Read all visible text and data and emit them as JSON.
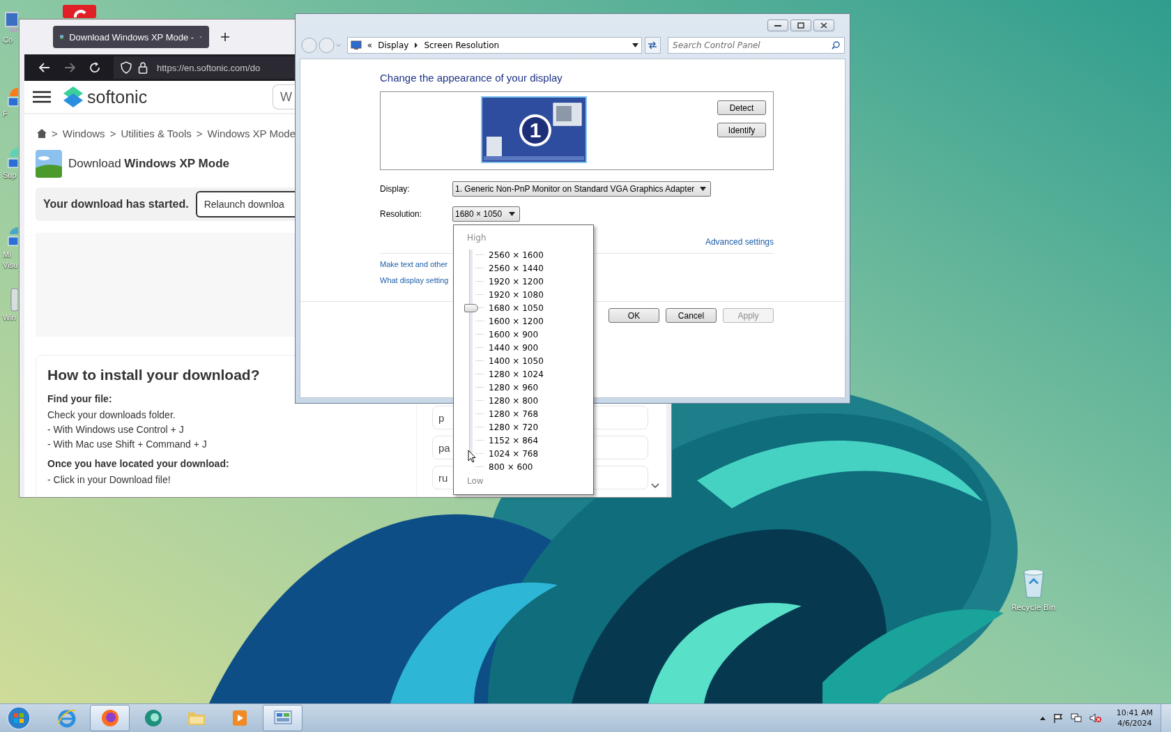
{
  "desktop": {
    "icons": [
      {
        "kind": "computer",
        "label": "Co"
      },
      {
        "kind": "firefox",
        "label": "F"
      },
      {
        "kind": "support",
        "label": "Sup"
      },
      {
        "kind": "studio",
        "label": "Mi Visu"
      },
      {
        "kind": "drive",
        "label": "Win"
      }
    ],
    "recycle_bin": {
      "label": "Recycle Bin"
    }
  },
  "browser": {
    "tab_title": "Download Windows XP Mode -",
    "url": "https://en.softonic.com/do",
    "logo": "softonic",
    "search": "W",
    "breadcrumb": [
      "Windows",
      "Utilities & Tools",
      "Windows XP Mode"
    ],
    "separator": ">",
    "title": "Download **Windows XP Mode**",
    "notice": "Your download has started.",
    "relaunch": "Relaunch downloa",
    "install": {
      "heading": "How to install your download?",
      "lines": [
        {
          "kind": "subheading",
          "text": "Find your file:"
        },
        {
          "kind": "text",
          "text": "Check your downloads folder."
        },
        {
          "kind": "text",
          "text": "- With Windows use Control + J"
        },
        {
          "kind": "text",
          "text": "- With Mac use Shift + Command + J"
        },
        {
          "kind": "subheading",
          "text": "Once you have located your download:"
        },
        {
          "kind": "text",
          "text": "- Click in your Download file!"
        }
      ]
    },
    "side_cards": [
      "p",
      "pa",
      "ru"
    ]
  },
  "dialog": {
    "address_back": "«",
    "breadcrumb": [
      "Display",
      "Screen Resolution"
    ],
    "search_placeholder": "Search Control Panel",
    "heading": "Change the appearance of your display",
    "monitor_number": "1",
    "detect": "Detect",
    "identify": "Identify",
    "display_label": "Display:",
    "display_value": "1. Generic Non-PnP Monitor on Standard VGA Graphics Adapter",
    "resolution_label": "Resolution:",
    "resolution_value": "1680 × 1050",
    "advanced": "Advanced settings",
    "links": [
      "Make text and other",
      "What display setting"
    ],
    "buttons": [
      {
        "label": "OK",
        "disabled": false
      },
      {
        "label": "Cancel",
        "disabled": false
      },
      {
        "label": "Apply",
        "disabled": true
      }
    ],
    "resolution_menu": {
      "high": "High",
      "low": "Low",
      "options": [
        {
          "label": "2560 × 1600",
          "selected": false
        },
        {
          "label": "2560 × 1440",
          "selected": false
        },
        {
          "label": "1920 × 1200",
          "selected": false
        },
        {
          "label": "1920 × 1080",
          "selected": false
        },
        {
          "label": "1680 × 1050",
          "selected": true
        },
        {
          "label": "1600 × 1200",
          "selected": false
        },
        {
          "label": "1600 × 900",
          "selected": false
        },
        {
          "label": "1440 × 900",
          "selected": false
        },
        {
          "label": "1400 × 1050",
          "selected": false
        },
        {
          "label": "1280 × 1024",
          "selected": false
        },
        {
          "label": "1280 × 960",
          "selected": false
        },
        {
          "label": "1280 × 800",
          "selected": false
        },
        {
          "label": "1280 × 768",
          "selected": false
        },
        {
          "label": "1280 × 720",
          "selected": false
        },
        {
          "label": "1152 × 864",
          "selected": false
        },
        {
          "label": "1024 × 768",
          "selected": false
        },
        {
          "label": "800 × 600",
          "selected": false
        }
      ]
    }
  },
  "taskbar": {
    "apps": [
      {
        "kind": "ie",
        "active": false
      },
      {
        "kind": "firefox",
        "active": true
      },
      {
        "kind": "chat",
        "active": false
      },
      {
        "kind": "folder",
        "active": false
      },
      {
        "kind": "media",
        "active": false
      },
      {
        "kind": "control_panel",
        "active": true
      }
    ],
    "tray": {
      "time": "10:41 AM",
      "date": "4/6/2024",
      "volume_muted": true
    }
  }
}
